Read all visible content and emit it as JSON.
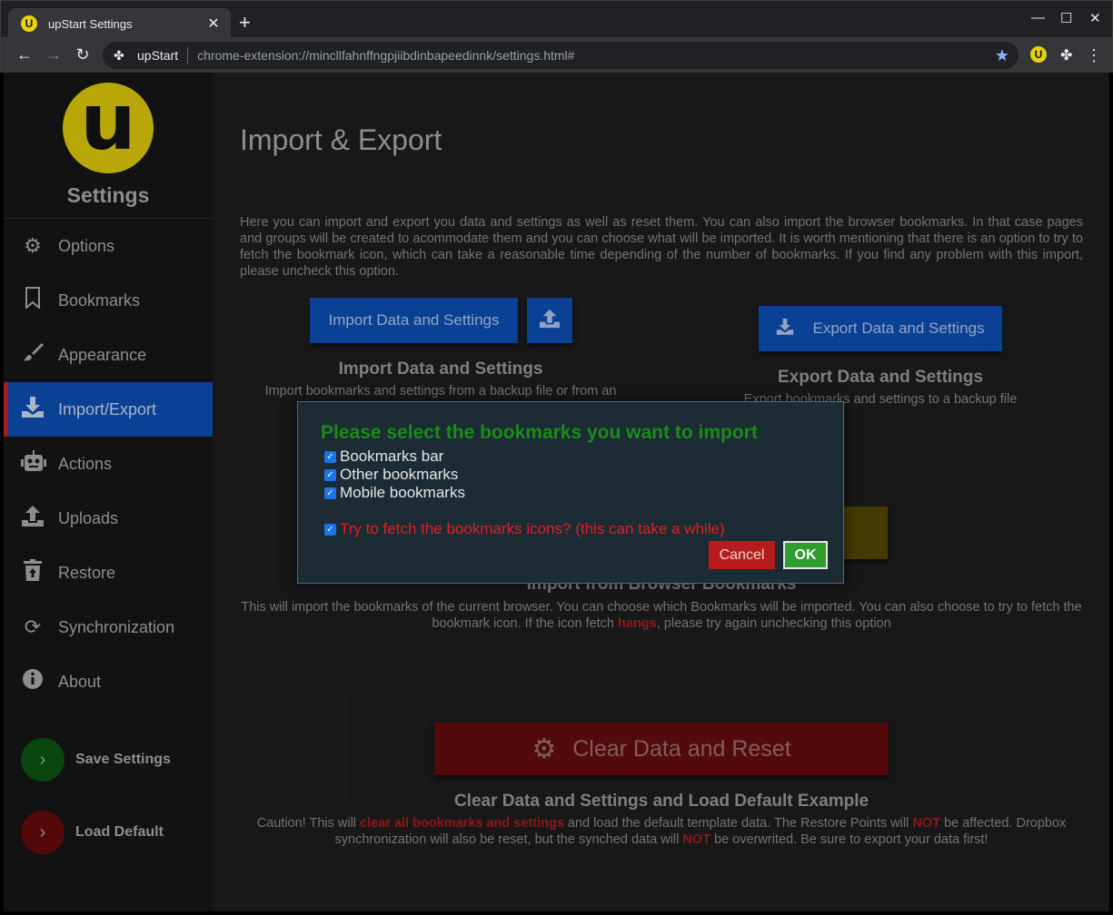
{
  "browser": {
    "tab_title": "upStart Settings",
    "tab_close": "✕",
    "new_tab": "+",
    "favicon_letter": "U",
    "window": {
      "minimize": "—",
      "maximize": "☐",
      "close": "✕"
    },
    "nav": {
      "back": "←",
      "forward": "→",
      "reload": "↻"
    },
    "address": {
      "extension_icon": "puzzle-icon",
      "site_name": "upStart",
      "url": "chrome-extension://mincllfahnffngpjiibdinbapeedinnk/settings.html#",
      "bookmark_star": "★"
    },
    "toolbar_icons": {
      "upstart_letter": "U",
      "extensions": "✤",
      "menu": "⋮"
    }
  },
  "sidebar": {
    "logo_letter": "u",
    "title": "Settings",
    "items": [
      {
        "label": "Options",
        "icon": "⚙",
        "icon_name": "gear-icon"
      },
      {
        "label": "Bookmarks",
        "icon": "🔖",
        "icon_name": "bookmark-icon"
      },
      {
        "label": "Appearance",
        "icon": "🖌",
        "icon_name": "brush-icon"
      },
      {
        "label": "Import/Export",
        "icon": "⇩",
        "icon_name": "download-icon",
        "active": true
      },
      {
        "label": "Actions",
        "icon": "🤖",
        "icon_name": "robot-icon"
      },
      {
        "label": "Uploads",
        "icon": "⇧",
        "icon_name": "upload-icon"
      },
      {
        "label": "Restore",
        "icon": "🗑",
        "icon_name": "trash-restore-icon"
      },
      {
        "label": "Synchronization",
        "icon": "⟳",
        "icon_name": "sync-icon"
      },
      {
        "label": "About",
        "icon": "ℹ",
        "icon_name": "info-icon"
      }
    ],
    "save_label": "Save Settings",
    "load_label": "Load Default",
    "chevron": "›"
  },
  "main": {
    "heading": "Import & Export",
    "intro": "Here you can import and export you data and settings as well as reset them. You can also import the browser bookmarks. In that case pages and groups will be created to acommodate them and you can choose what will be imported. It is worth mentioning that there is an option to try to fetch the bookmark icon, which can take a reasonable time depending of the number of bookmarks. If you find any problem with this import, please uncheck this option.",
    "import": {
      "button_label": "Import Data and Settings",
      "upload_icon": "⇪",
      "title": "Import Data and Settings",
      "desc": "Import bookmarks and settings from a backup file or from an"
    },
    "export": {
      "icon": "⇩",
      "button_label": "Export Data and Settings",
      "title": "Export Data and Settings",
      "desc": "Export bookmarks and settings to a backup file"
    },
    "browser_import": {
      "title": "Import from Browser Bookmarks",
      "desc_before": "This will import the bookmarks of the current browser. You can choose which Bookmarks will be imported. You can also choose to try to fetch the bookmark icon. If the icon fetch ",
      "desc_highlight": "hangs",
      "desc_after": ", please try again unchecking this option"
    },
    "reset": {
      "icon": "⚙",
      "button_label": "Clear Data and Reset",
      "title": "Clear Data and Settings and Load Default Example",
      "desc_1": "Caution! This will ",
      "desc_hl_1": "clear all bookmarks and settings",
      "desc_2": " and load the default template data. The Restore Points will ",
      "desc_hl_2": "NOT",
      "desc_3": " be affected. Dropbox synchronization will also be reset, but the synched data will ",
      "desc_hl_3": "NOT",
      "desc_4": " be overwrited. Be sure to export your data first!"
    }
  },
  "modal": {
    "title": "Please select the bookmarks you want to import",
    "options": [
      {
        "label": "Bookmarks bar",
        "checked": true
      },
      {
        "label": "Other bookmarks",
        "checked": true
      },
      {
        "label": "Mobile bookmarks",
        "checked": true
      }
    ],
    "fetch_icons_label": "Try to fetch the bookmarks icons? (this can take a while)",
    "fetch_icons_checked": true,
    "cancel_label": "Cancel",
    "ok_label": "OK",
    "check_glyph": "✓"
  },
  "colors": {
    "accent_blue": "#0d47a1",
    "danger_red": "#b71c1c",
    "ok_green": "#2e9e2e",
    "modal_title_green": "#1a8c1a",
    "logo_yellow": "#c9b50a"
  }
}
